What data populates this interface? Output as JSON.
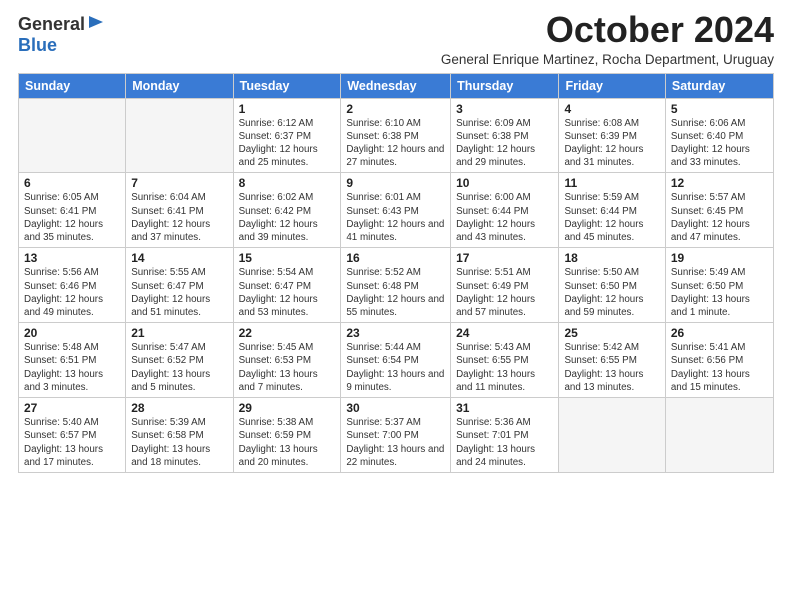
{
  "logo": {
    "general": "General",
    "blue": "Blue"
  },
  "title": {
    "month_year": "October 2024",
    "location": "General Enrique Martinez, Rocha Department, Uruguay"
  },
  "days_of_week": [
    "Sunday",
    "Monday",
    "Tuesday",
    "Wednesday",
    "Thursday",
    "Friday",
    "Saturday"
  ],
  "weeks": [
    [
      {
        "num": "",
        "info": ""
      },
      {
        "num": "",
        "info": ""
      },
      {
        "num": "1",
        "info": "Sunrise: 6:12 AM\nSunset: 6:37 PM\nDaylight: 12 hours and 25 minutes."
      },
      {
        "num": "2",
        "info": "Sunrise: 6:10 AM\nSunset: 6:38 PM\nDaylight: 12 hours and 27 minutes."
      },
      {
        "num": "3",
        "info": "Sunrise: 6:09 AM\nSunset: 6:38 PM\nDaylight: 12 hours and 29 minutes."
      },
      {
        "num": "4",
        "info": "Sunrise: 6:08 AM\nSunset: 6:39 PM\nDaylight: 12 hours and 31 minutes."
      },
      {
        "num": "5",
        "info": "Sunrise: 6:06 AM\nSunset: 6:40 PM\nDaylight: 12 hours and 33 minutes."
      }
    ],
    [
      {
        "num": "6",
        "info": "Sunrise: 6:05 AM\nSunset: 6:41 PM\nDaylight: 12 hours and 35 minutes."
      },
      {
        "num": "7",
        "info": "Sunrise: 6:04 AM\nSunset: 6:41 PM\nDaylight: 12 hours and 37 minutes."
      },
      {
        "num": "8",
        "info": "Sunrise: 6:02 AM\nSunset: 6:42 PM\nDaylight: 12 hours and 39 minutes."
      },
      {
        "num": "9",
        "info": "Sunrise: 6:01 AM\nSunset: 6:43 PM\nDaylight: 12 hours and 41 minutes."
      },
      {
        "num": "10",
        "info": "Sunrise: 6:00 AM\nSunset: 6:44 PM\nDaylight: 12 hours and 43 minutes."
      },
      {
        "num": "11",
        "info": "Sunrise: 5:59 AM\nSunset: 6:44 PM\nDaylight: 12 hours and 45 minutes."
      },
      {
        "num": "12",
        "info": "Sunrise: 5:57 AM\nSunset: 6:45 PM\nDaylight: 12 hours and 47 minutes."
      }
    ],
    [
      {
        "num": "13",
        "info": "Sunrise: 5:56 AM\nSunset: 6:46 PM\nDaylight: 12 hours and 49 minutes."
      },
      {
        "num": "14",
        "info": "Sunrise: 5:55 AM\nSunset: 6:47 PM\nDaylight: 12 hours and 51 minutes."
      },
      {
        "num": "15",
        "info": "Sunrise: 5:54 AM\nSunset: 6:47 PM\nDaylight: 12 hours and 53 minutes."
      },
      {
        "num": "16",
        "info": "Sunrise: 5:52 AM\nSunset: 6:48 PM\nDaylight: 12 hours and 55 minutes."
      },
      {
        "num": "17",
        "info": "Sunrise: 5:51 AM\nSunset: 6:49 PM\nDaylight: 12 hours and 57 minutes."
      },
      {
        "num": "18",
        "info": "Sunrise: 5:50 AM\nSunset: 6:50 PM\nDaylight: 12 hours and 59 minutes."
      },
      {
        "num": "19",
        "info": "Sunrise: 5:49 AM\nSunset: 6:50 PM\nDaylight: 13 hours and 1 minute."
      }
    ],
    [
      {
        "num": "20",
        "info": "Sunrise: 5:48 AM\nSunset: 6:51 PM\nDaylight: 13 hours and 3 minutes."
      },
      {
        "num": "21",
        "info": "Sunrise: 5:47 AM\nSunset: 6:52 PM\nDaylight: 13 hours and 5 minutes."
      },
      {
        "num": "22",
        "info": "Sunrise: 5:45 AM\nSunset: 6:53 PM\nDaylight: 13 hours and 7 minutes."
      },
      {
        "num": "23",
        "info": "Sunrise: 5:44 AM\nSunset: 6:54 PM\nDaylight: 13 hours and 9 minutes."
      },
      {
        "num": "24",
        "info": "Sunrise: 5:43 AM\nSunset: 6:55 PM\nDaylight: 13 hours and 11 minutes."
      },
      {
        "num": "25",
        "info": "Sunrise: 5:42 AM\nSunset: 6:55 PM\nDaylight: 13 hours and 13 minutes."
      },
      {
        "num": "26",
        "info": "Sunrise: 5:41 AM\nSunset: 6:56 PM\nDaylight: 13 hours and 15 minutes."
      }
    ],
    [
      {
        "num": "27",
        "info": "Sunrise: 5:40 AM\nSunset: 6:57 PM\nDaylight: 13 hours and 17 minutes."
      },
      {
        "num": "28",
        "info": "Sunrise: 5:39 AM\nSunset: 6:58 PM\nDaylight: 13 hours and 18 minutes."
      },
      {
        "num": "29",
        "info": "Sunrise: 5:38 AM\nSunset: 6:59 PM\nDaylight: 13 hours and 20 minutes."
      },
      {
        "num": "30",
        "info": "Sunrise: 5:37 AM\nSunset: 7:00 PM\nDaylight: 13 hours and 22 minutes."
      },
      {
        "num": "31",
        "info": "Sunrise: 5:36 AM\nSunset: 7:01 PM\nDaylight: 13 hours and 24 minutes."
      },
      {
        "num": "",
        "info": ""
      },
      {
        "num": "",
        "info": ""
      }
    ]
  ]
}
